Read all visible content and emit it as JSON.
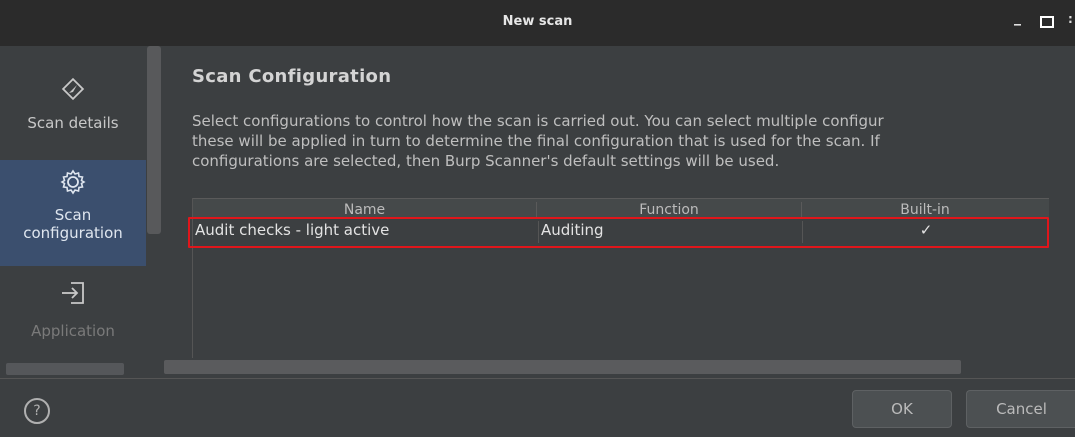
{
  "window": {
    "title": "New scan"
  },
  "sidebar": {
    "items": [
      {
        "label": "Scan details",
        "icon": "compass-icon"
      },
      {
        "label": "Scan configuration",
        "icon": "gear-icon"
      },
      {
        "label": "Application",
        "icon": "login-icon"
      }
    ]
  },
  "main": {
    "heading": "Scan Configuration",
    "description": [
      "Select configurations to control how the scan is carried out. You can select multiple configur",
      "these will be applied in turn to determine the final configuration that is used for the scan. If",
      "configurations are selected, then Burp Scanner's default settings will be used."
    ]
  },
  "table": {
    "columns": [
      "Name",
      "Function",
      "Built-in"
    ],
    "rows": [
      {
        "name": "Audit checks - light active",
        "function": "Auditing",
        "builtin": "✓"
      }
    ]
  },
  "footer": {
    "ok_label": "OK",
    "cancel_label": "Cancel",
    "help_glyph": "?"
  },
  "colors": {
    "highlight": "#e0161b",
    "active_sidebar": "#3b4f6e"
  }
}
